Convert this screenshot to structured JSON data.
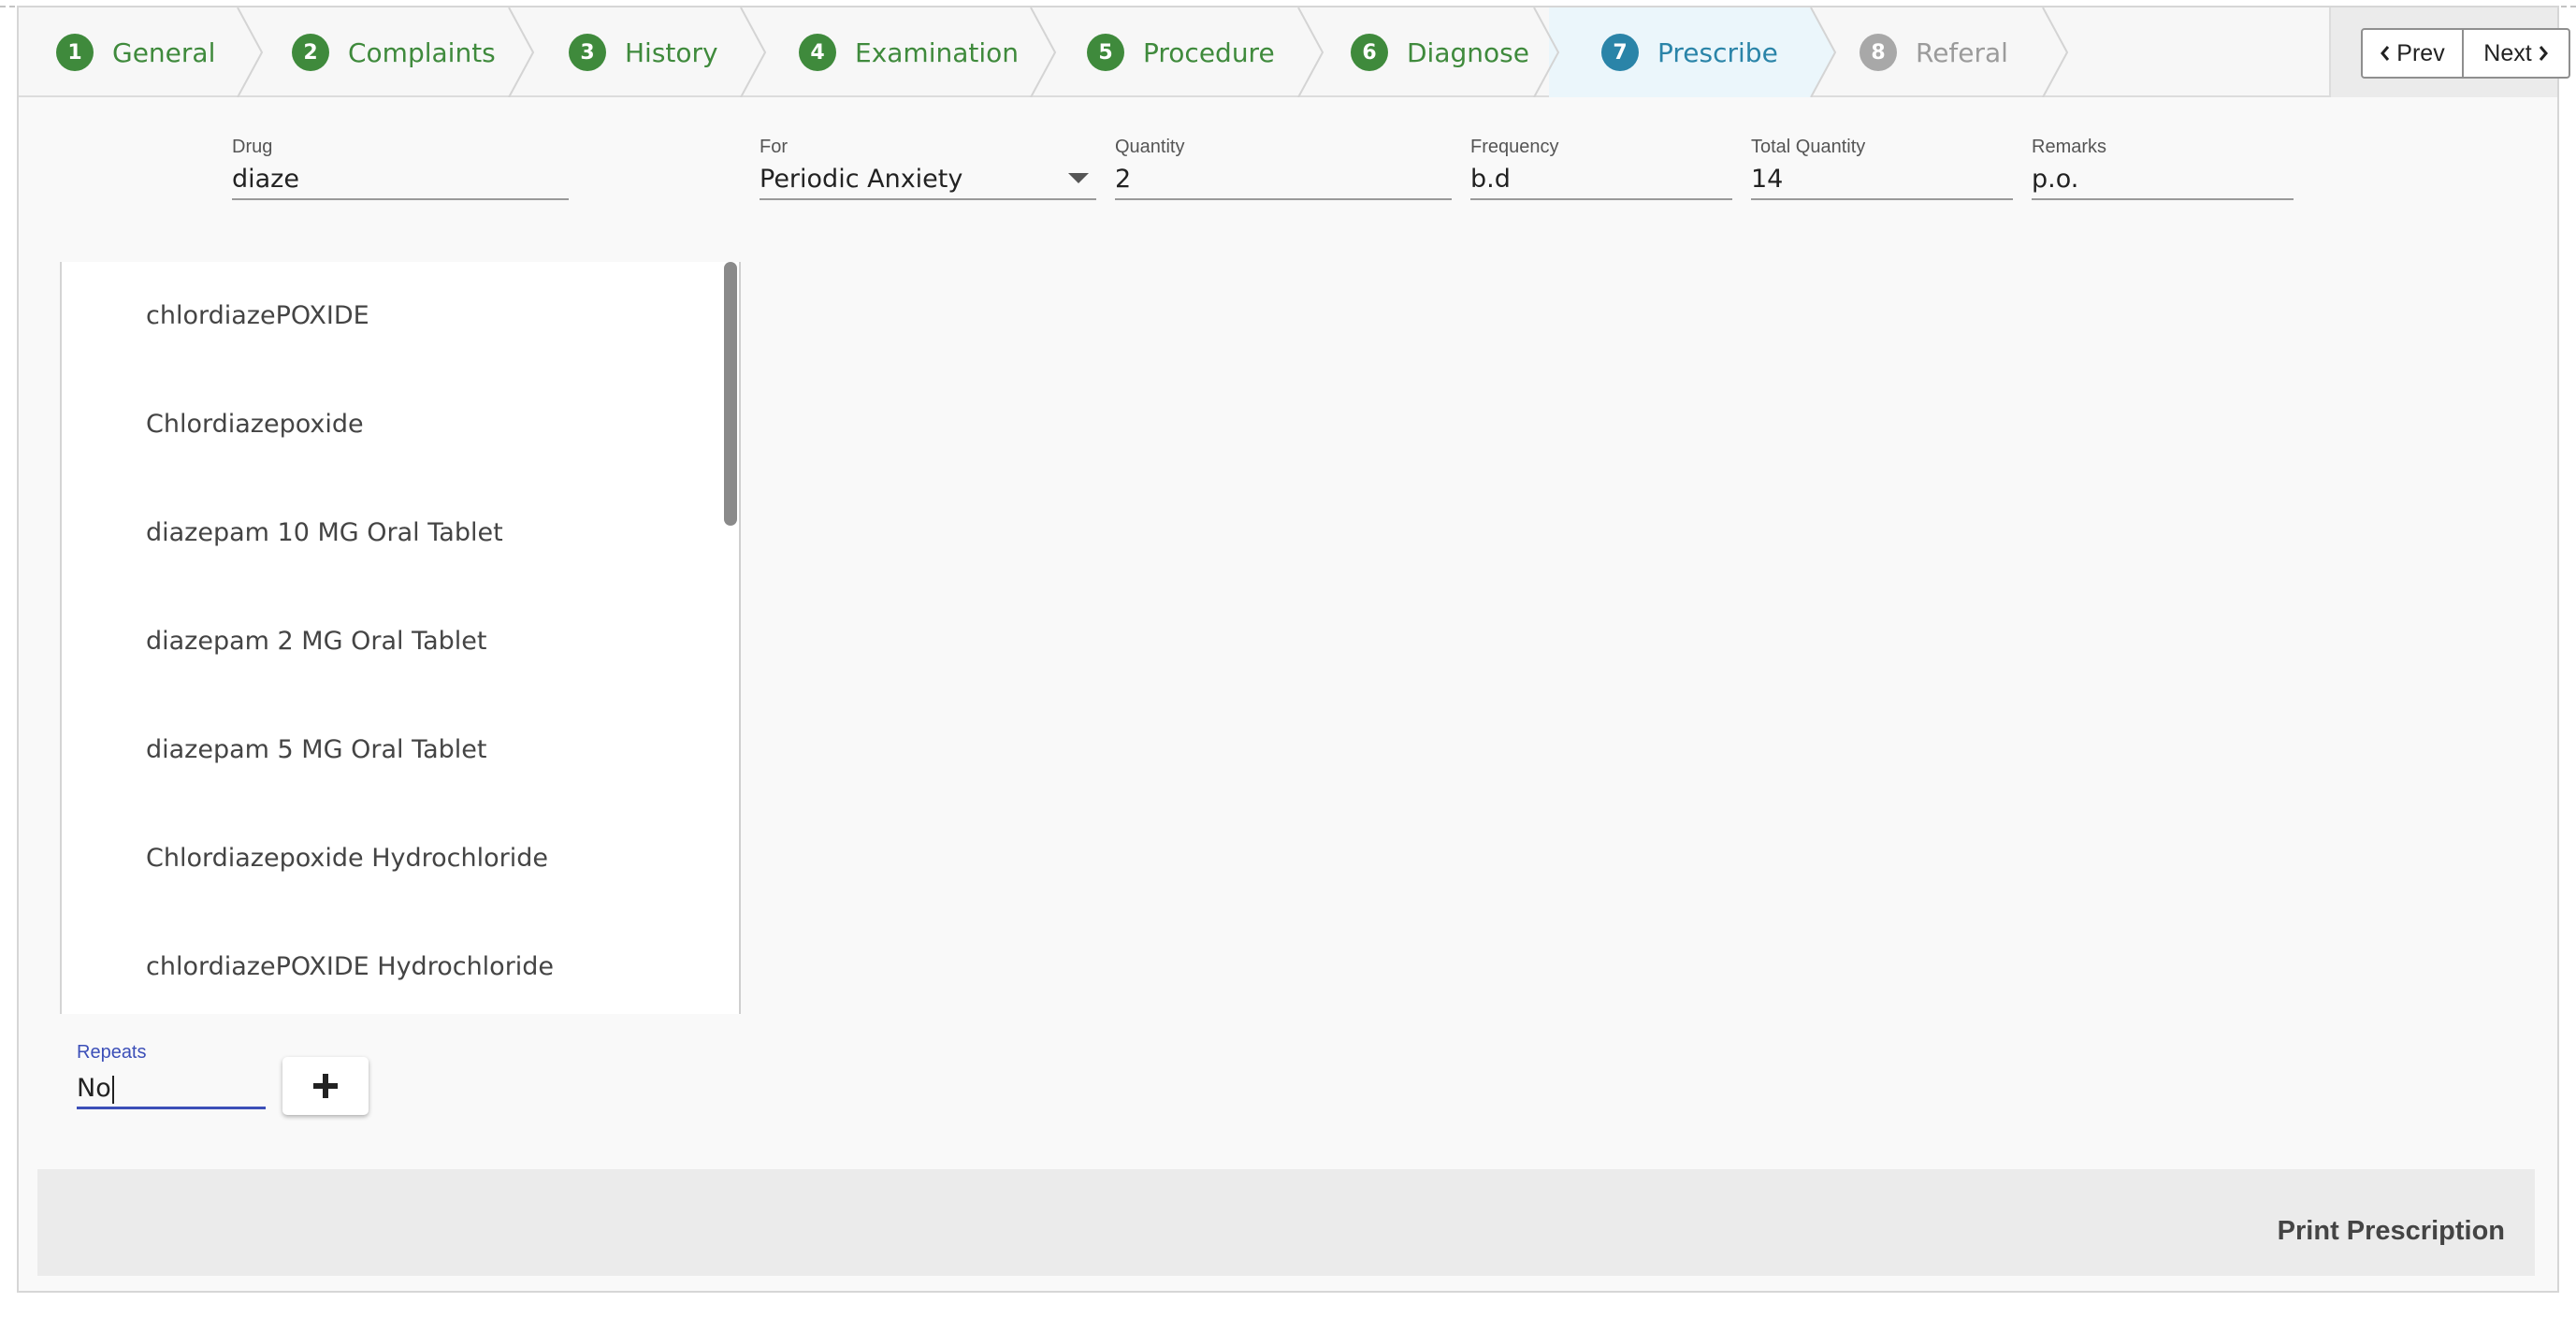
{
  "steps": [
    {
      "number": "1",
      "label": "General"
    },
    {
      "number": "2",
      "label": "Complaints"
    },
    {
      "number": "3",
      "label": "History"
    },
    {
      "number": "4",
      "label": "Examination"
    },
    {
      "number": "5",
      "label": "Procedure"
    },
    {
      "number": "6",
      "label": "Diagnose"
    },
    {
      "number": "7",
      "label": "Prescribe"
    },
    {
      "number": "8",
      "label": "Referal"
    }
  ],
  "active_step": "Prescribe",
  "nav": {
    "prev_label": "Prev",
    "next_label": "Next"
  },
  "form": {
    "drug": {
      "label": "Drug",
      "value": "diaze"
    },
    "for": {
      "label": "For",
      "value": "Periodic Anxiety"
    },
    "quantity": {
      "label": "Quantity",
      "value": "2"
    },
    "frequency": {
      "label": "Frequency",
      "value": "b.d"
    },
    "total_quantity": {
      "label": "Total Quantity",
      "value": "14"
    },
    "remarks": {
      "label": "Remarks",
      "value": "p.o."
    }
  },
  "suggestions": [
    "chlordiazePOXIDE",
    "Chlordiazepoxide",
    "diazepam 10 MG Oral Tablet",
    "diazepam 2 MG Oral Tablet",
    "diazepam 5 MG Oral Tablet",
    "Chlordiazepoxide Hydrochloride",
    "chlordiazePOXIDE Hydrochloride"
  ],
  "repeats": {
    "label": "Repeats",
    "value": "No"
  },
  "add_button_icon": "plus-icon",
  "footer": {
    "print_label": "Print Prescription"
  },
  "colors": {
    "complete": "#3f8a3c",
    "active": "#2a84a8",
    "disabled": "#a8a8a8",
    "focus": "#3c4fb8"
  }
}
